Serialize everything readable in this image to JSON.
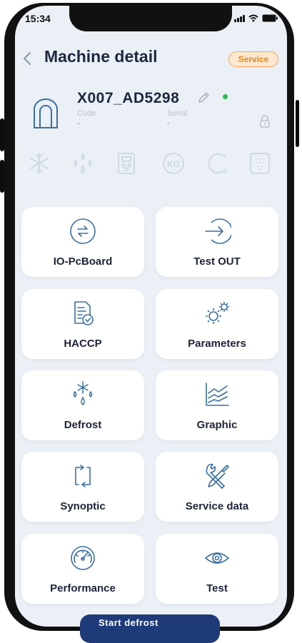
{
  "status_bar": {
    "time": "15:34"
  },
  "header": {
    "title": "Machine detail",
    "badge": "Service"
  },
  "machine": {
    "name": "X007_AD5298",
    "code_label": "Code",
    "code_value": "-",
    "serial_label": "Serial",
    "serial_value": "-",
    "online": true
  },
  "feature_icons": [
    "snowflake-icon",
    "droplets-icon",
    "device-icon",
    "kg-weight-icon",
    "cycle-3-icon",
    "shower-icon"
  ],
  "tiles": [
    {
      "label": "IO-PcBoard",
      "icon": "arrows-exchange-icon"
    },
    {
      "label": "Test OUT",
      "icon": "arrow-circle-right-icon"
    },
    {
      "label": "HACCP",
      "icon": "document-check-icon"
    },
    {
      "label": "Parameters",
      "icon": "gears-icon"
    },
    {
      "label": "Defrost",
      "icon": "snowflake-drops-icon"
    },
    {
      "label": "Graphic",
      "icon": "line-chart-icon"
    },
    {
      "label": "Synoptic",
      "icon": "refresh-square-icon"
    },
    {
      "label": "Service data",
      "icon": "tools-icon"
    },
    {
      "label": "Performance",
      "icon": "gauge-icon"
    },
    {
      "label": "Test",
      "icon": "eye-icon"
    }
  ],
  "bottom_button": {
    "label": "Start defrost"
  },
  "colors": {
    "background": "#eaf0f5",
    "tile_icon": "#3b6fa0",
    "title": "#1b2840",
    "badge_border": "#f3a55a",
    "badge_text": "#e6861c",
    "online_dot": "#2fba53",
    "bottom_button": "#1f3a78"
  }
}
